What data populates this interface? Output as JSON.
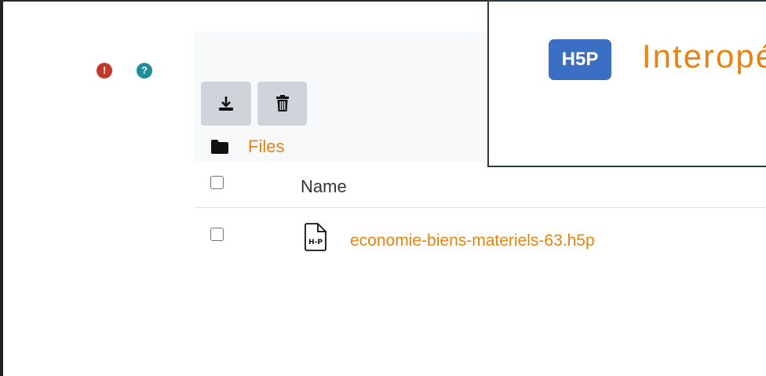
{
  "status": {
    "error_symbol": "!",
    "help_symbol": "?"
  },
  "toolbar": {
    "download_icon": "download-icon",
    "delete_icon": "trash-icon"
  },
  "breadcrumb": {
    "folder_icon": "folder-icon",
    "label": "Files"
  },
  "table": {
    "columns": [
      "Name"
    ],
    "rows": [
      {
        "name": "economie-biens-materiels-63.h5p",
        "icon": "h5p-file-icon"
      }
    ]
  },
  "popup": {
    "logo_text": "H5P",
    "title": "Interopé"
  },
  "colors": {
    "accent": "#e8830f",
    "error": "#c0392b",
    "help": "#1f8c9c",
    "logo": "#3a6fc4"
  }
}
